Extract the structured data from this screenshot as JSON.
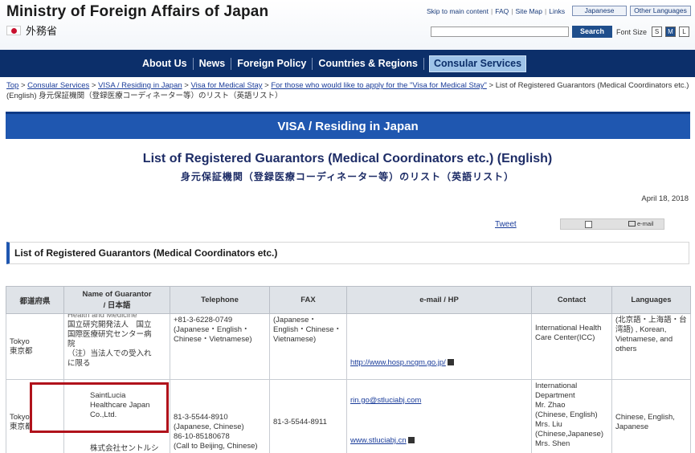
{
  "header": {
    "title": "Ministry of Foreign Affairs of Japan",
    "subtitle_ja": "外務省",
    "util_links": [
      "Skip to main content",
      "FAQ",
      "Site Map",
      "Links"
    ],
    "lang_japanese": "Japanese",
    "lang_other": "Other Languages",
    "search_placeholder": "",
    "search_label": "Search",
    "font_size_label": "Font Size",
    "font_sizes": [
      "S",
      "M",
      "L"
    ]
  },
  "nav": {
    "items": [
      "About Us",
      "News",
      "Foreign Policy",
      "Countries & Regions",
      "Consular Services"
    ],
    "active": "Consular Services"
  },
  "breadcrumb": {
    "links": [
      "Top",
      "Consular Services",
      "VISA / Residing in Japan",
      "Visa for Medical Stay",
      "For those who would like to apply for the \"Visa for Medical Stay\""
    ],
    "current": "List of Registered Guarantors (Medical Coordinators etc.) (English) 身元保証機関（登録医療コーディネーター等）のリスト（英語リスト）"
  },
  "banner": "VISA / Residing in Japan",
  "title": "List of Registered Guarantors (Medical Coordinators etc.) (English)",
  "title_ja": "身元保証機関（登録医療コーディネーター等）のリスト（英語リスト）",
  "date": "April 18, 2018",
  "tweet": "Tweet",
  "share_mail": "e-mail",
  "list_heading": "List of Registered Guarantors (Medical Coordinators etc.)",
  "table": {
    "headers": {
      "pref": "都道府県",
      "name": "Name of Guarantor",
      "name_ja": "/ 日本語",
      "tel": "Telephone",
      "fax": "FAX",
      "email": "e-mail / HP",
      "contact": "Contact",
      "langs": "Languages"
    },
    "rows": [
      {
        "pref": "Tokyo",
        "pref_ja": "東京都",
        "name_lines": [
          "Health and Medicine",
          "国立研究開発法人　国立",
          "国際医療研究センター病",
          "院",
          "（注）当法人での受入れ",
          "に限る"
        ],
        "tel": "+81-3-6228-0749",
        "tel2": "(Japanese・English・Chinese・Vietnamese)",
        "fax": "(Japanese・English・Chinese・Vietnamese)",
        "hp": "http://www.hosp.ncgm.go.jp/",
        "contact": "International Health Care Center(ICC)",
        "langs": "(北京語・上海語・台湾語) , Korean, Vietnamese, and others"
      },
      {
        "pref": "Tokyo",
        "pref_ja": "東京都",
        "name_en": "SaintLucia Healthcare Japan Co.,Ltd.",
        "name_ja": "株式会社セントルシアヘルスケアジャパン",
        "tel": "81-3-5544-8910",
        "tel_note": "(Japanese, Chinese)",
        "tel2": "86-10-85180678",
        "tel2_note": "(Call to Beijing, Chinese)",
        "fax": "81-3-5544-8911",
        "email": "rin.go@stluciabj.com",
        "hp": "www.stluciabj.cn",
        "contact_lines": [
          "International",
          "Department",
          "Mr. Zhao",
          "(Chinese, English)",
          "Mrs. Liu",
          "(Chinese,Japanese)",
          "Mrs. Shen"
        ],
        "langs": "Chinese, English, Japanese"
      }
    ]
  }
}
